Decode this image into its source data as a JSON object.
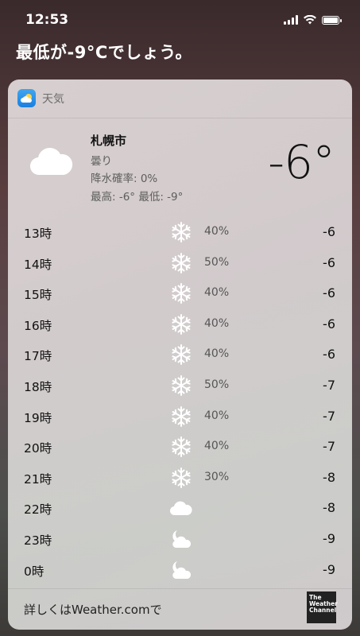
{
  "status": {
    "time": "12:53"
  },
  "siri": {
    "query_response": "最低が-9°Cでしょう。"
  },
  "card": {
    "app_name": "天気",
    "city": "札幌市",
    "condition": "曇り",
    "precip": "降水確率: 0%",
    "hilo": "最高: -6° 最低: -9°",
    "current_temp": "-6°",
    "hours": [
      {
        "hour": "13時",
        "icon": "snowflake-icon",
        "pct": "40%",
        "temp": "-6"
      },
      {
        "hour": "14時",
        "icon": "snowflake-icon",
        "pct": "50%",
        "temp": "-6"
      },
      {
        "hour": "15時",
        "icon": "snowflake-icon",
        "pct": "40%",
        "temp": "-6"
      },
      {
        "hour": "16時",
        "icon": "snowflake-icon",
        "pct": "40%",
        "temp": "-6"
      },
      {
        "hour": "17時",
        "icon": "snowflake-icon",
        "pct": "40%",
        "temp": "-6"
      },
      {
        "hour": "18時",
        "icon": "snowflake-icon",
        "pct": "50%",
        "temp": "-7"
      },
      {
        "hour": "19時",
        "icon": "snowflake-icon",
        "pct": "40%",
        "temp": "-7"
      },
      {
        "hour": "20時",
        "icon": "snowflake-icon",
        "pct": "40%",
        "temp": "-7"
      },
      {
        "hour": "21時",
        "icon": "snowflake-icon",
        "pct": "30%",
        "temp": "-8"
      },
      {
        "hour": "22時",
        "icon": "cloud-icon",
        "pct": "",
        "temp": "-8"
      },
      {
        "hour": "23時",
        "icon": "moon-cloud-icon",
        "pct": "",
        "temp": "-9"
      },
      {
        "hour": "0時",
        "icon": "moon-cloud-icon",
        "pct": "",
        "temp": "-9"
      }
    ],
    "footer_link": "詳しくはWeather.comで",
    "provider_logo_text": "The Weather Channel"
  }
}
